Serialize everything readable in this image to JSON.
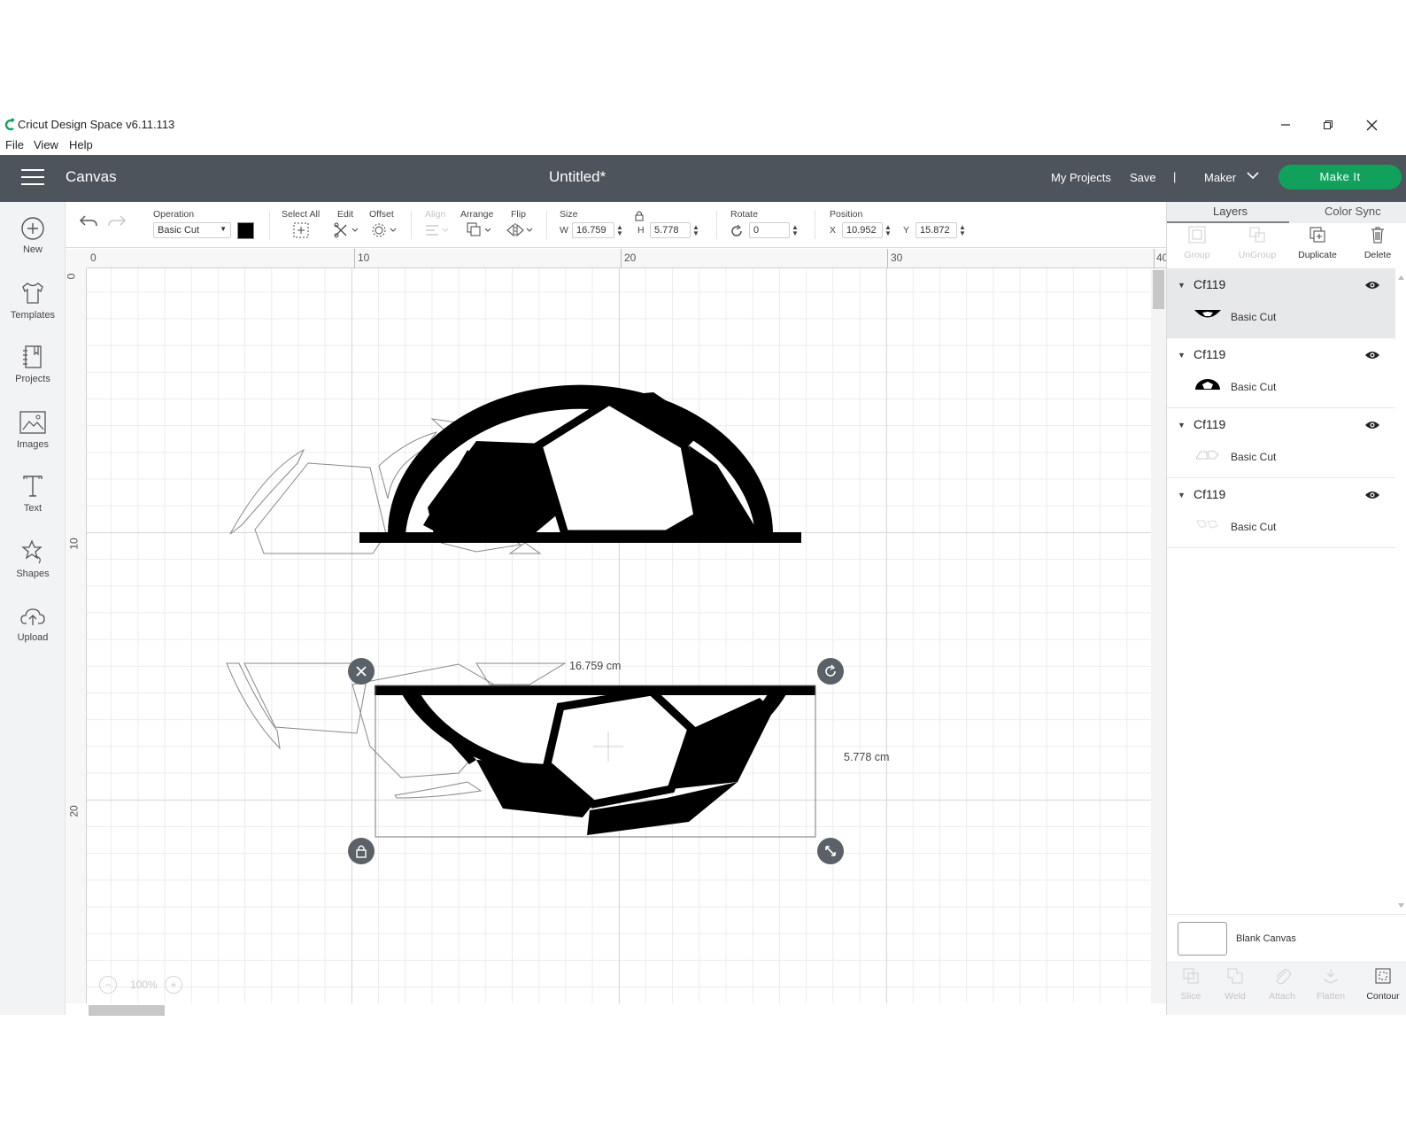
{
  "window": {
    "app_title": "Cricut Design Space  v6.11.113"
  },
  "menu": [
    "File",
    "View",
    "Help"
  ],
  "header": {
    "section": "Canvas",
    "document_title": "Untitled*",
    "my_projects": "My Projects",
    "save": "Save",
    "separator": "|",
    "machine": "Maker",
    "make_it": "Make It"
  },
  "left_nav": [
    {
      "label": "New",
      "icon": "plus-circle-icon"
    },
    {
      "label": "Templates",
      "icon": "tshirt-icon"
    },
    {
      "label": "Projects",
      "icon": "notebook-icon"
    },
    {
      "label": "Images",
      "icon": "image-icon"
    },
    {
      "label": "Text",
      "icon": "text-t-icon"
    },
    {
      "label": "Shapes",
      "icon": "shapes-icon"
    },
    {
      "label": "Upload",
      "icon": "cloud-upload-icon"
    }
  ],
  "toolbar": {
    "operation_label": "Operation",
    "operation_value": "Basic Cut",
    "operation_color": "#000000",
    "select_all": "Select All",
    "edit": "Edit",
    "offset": "Offset",
    "align": "Align",
    "arrange": "Arrange",
    "flip": "Flip",
    "size_label": "Size",
    "w_label": "W",
    "w_value": "16.759",
    "h_label": "H",
    "h_value": "5.778",
    "rotate_label": "Rotate",
    "rotate_value": "0",
    "position_label": "Position",
    "x_label": "X",
    "x_value": "10.952",
    "y_label": "Y",
    "y_value": "15.872"
  },
  "rulers": {
    "top": [
      "0",
      "10",
      "20",
      "30",
      "40"
    ],
    "left": [
      "0",
      "10",
      "20"
    ]
  },
  "canvas": {
    "width_label": "16.759 cm",
    "height_label": "5.778 cm",
    "zoom_minus": "−",
    "zoom_value": "100%",
    "zoom_plus": "+"
  },
  "panel": {
    "tab_layers": "Layers",
    "tab_color_sync": "Color Sync",
    "tools": [
      "Group",
      "UnGroup",
      "Duplicate",
      "Delete"
    ],
    "layers": [
      {
        "name": "Cf119",
        "operation": "Basic Cut",
        "selected": true
      },
      {
        "name": "Cf119",
        "operation": "Basic Cut",
        "selected": false
      },
      {
        "name": "Cf119",
        "operation": "Basic Cut",
        "selected": false
      },
      {
        "name": "Cf119",
        "operation": "Basic Cut",
        "selected": false
      }
    ],
    "blank_canvas": "Blank Canvas",
    "bottom_tools": [
      "Slice",
      "Weld",
      "Attach",
      "Flatten",
      "Contour"
    ]
  },
  "colors": {
    "header_bg": "#4d545c",
    "make_it_green": "#12a15d",
    "design_fill": "#000000"
  }
}
